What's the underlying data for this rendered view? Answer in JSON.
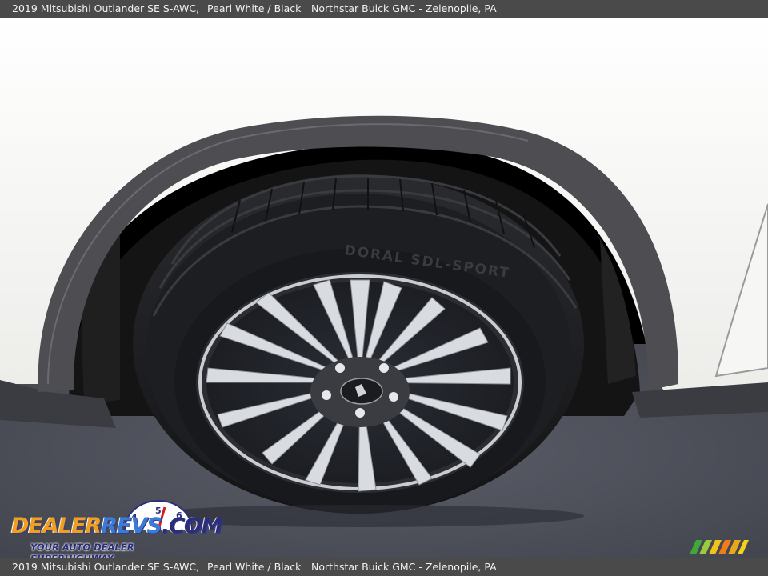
{
  "caption": {
    "vehicle": "2019 Mitsubishi Outlander SE S-AWC,",
    "color": "Pearl White / Black",
    "dealer": "Northstar Buick GMC - Zelenopile, PA"
  },
  "tire": {
    "brand_text": "DORAL SDL-SPORT"
  },
  "watermark": {
    "brand_part1": "DEALER",
    "brand_part2": "REVS",
    "brand_suffix": ".COM",
    "tagline": "YOUR AUTO DEALER SUPERHIGHWAY",
    "gauge_digits": [
      "4",
      "5",
      "6"
    ]
  },
  "colors": {
    "bar_bg": "#4a4a4a",
    "body_paint": "#f4f4f2",
    "fender_trim": "#4d4d52",
    "asphalt": "#4b4e58",
    "logo_orange": "#f0a020",
    "logo_blue": "#3a7bd5"
  }
}
